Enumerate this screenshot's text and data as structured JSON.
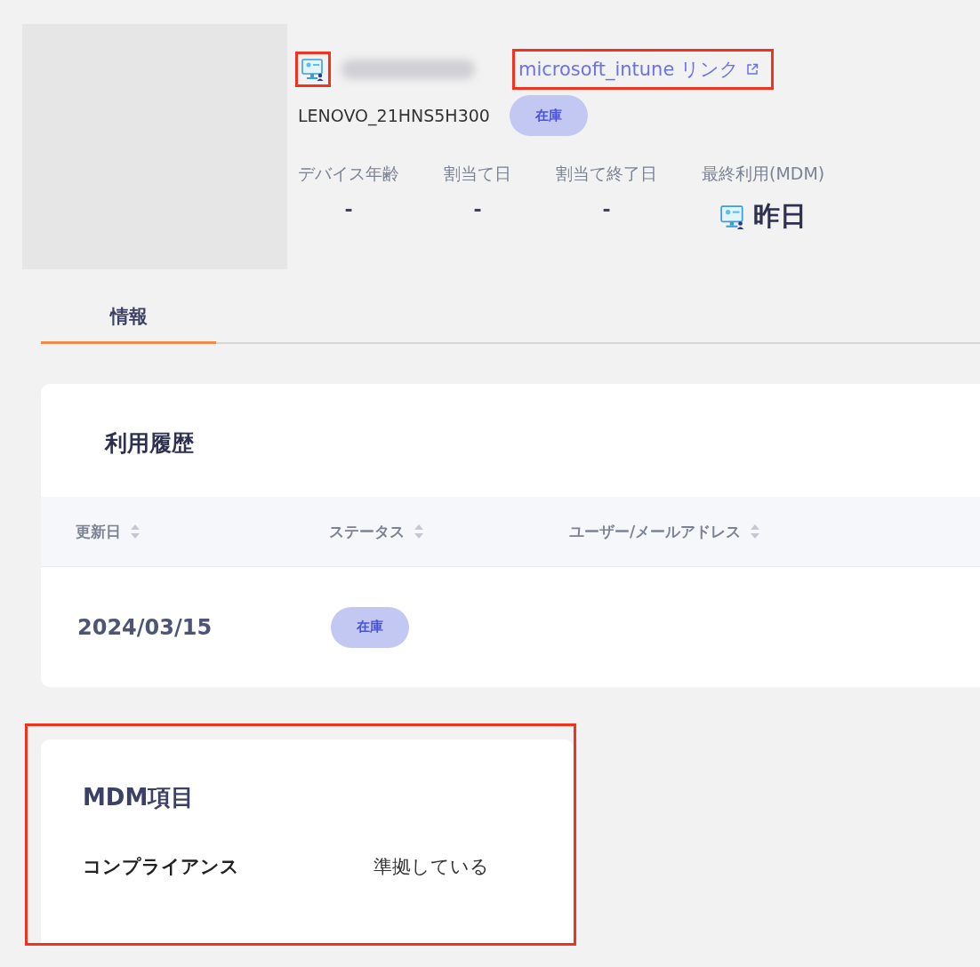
{
  "header": {
    "device_icon_highlighted": true,
    "link": {
      "text": "microsoft_intune リンク",
      "highlighted": true
    },
    "model": "LENOVO_21HNS5H300",
    "status": "在庫",
    "stats": [
      {
        "label": "デバイス年齢",
        "value": "-",
        "kind": "plain"
      },
      {
        "label": "割当て日",
        "value": "-",
        "kind": "plain"
      },
      {
        "label": "割当て終了日",
        "value": "-",
        "kind": "plain"
      },
      {
        "label": "最終利用(MDM)",
        "value": "昨日",
        "kind": "mdm"
      }
    ]
  },
  "tabs": [
    {
      "label": "情報",
      "selected": true
    }
  ],
  "usage_history": {
    "title": "利用履歴",
    "columns": [
      "更新日",
      "ステータス",
      "ユーザー/メールアドレス"
    ],
    "rows": [
      {
        "date": "2024/03/15",
        "status": "在庫"
      }
    ]
  },
  "mdm_section": {
    "title": "MDM項目",
    "highlighted": true,
    "items": [
      {
        "label": "コンプライアンス",
        "value": "準拠している"
      }
    ]
  }
}
